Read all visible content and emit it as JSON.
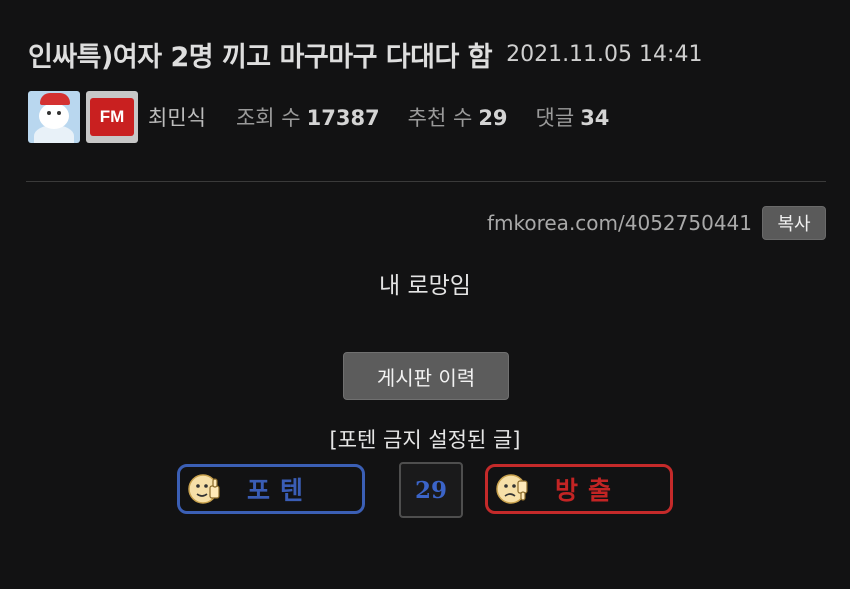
{
  "post": {
    "title": "인싸특)여자 2명 끼고 마구마구 다대다 함",
    "date": "2021.11.05 14:41",
    "author": "최민식",
    "views_label": "조회 수",
    "views": "17387",
    "recs_label": "추천 수",
    "recs": "29",
    "comments_label": "댓글",
    "comments": "34",
    "avatar_logo_text": "FM",
    "url": "fmkorea.com/4052750441",
    "copy_label": "복사",
    "body": "내 로망임",
    "history_label": "게시판 이력",
    "notice": "[포텐 금지 설정된 글]"
  },
  "vote": {
    "up_label": "포텐",
    "count": "29",
    "down_label": "방출",
    "up_color": "#3b5fb5",
    "down_color": "#c42a2a",
    "up_icon": "thumbs-up-face-icon",
    "down_icon": "thumbs-down-face-icon"
  },
  "colors": {
    "background": "#121213",
    "button": "#5c5c5c"
  }
}
